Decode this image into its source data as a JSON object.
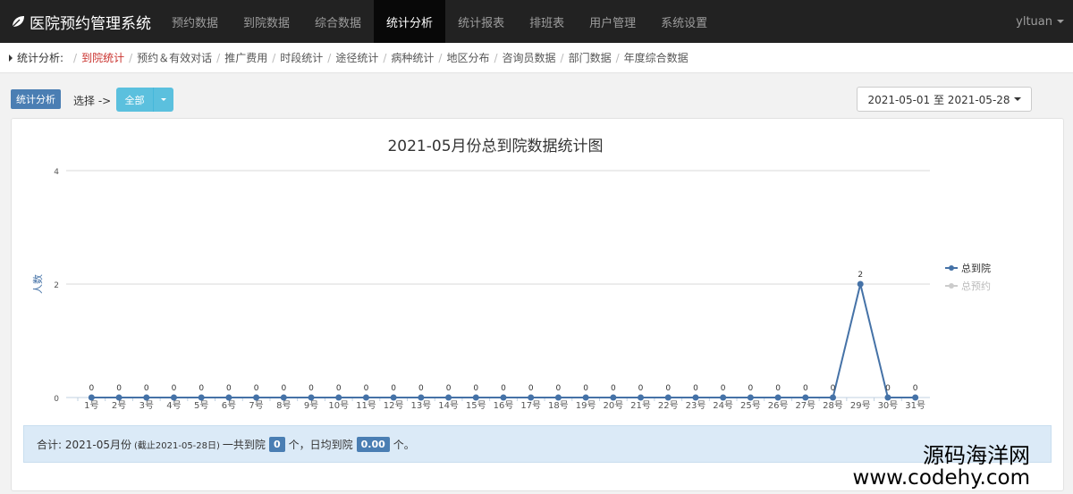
{
  "brand": {
    "title": "医院预约管理系统",
    "icon": "leaf-icon"
  },
  "nav": {
    "items": [
      "预约数据",
      "到院数据",
      "综合数据",
      "统计分析",
      "统计报表",
      "排班表",
      "用户管理",
      "系统设置"
    ],
    "active_index": 3,
    "user": "yltuan"
  },
  "breadcrumb": {
    "title": "统计分析:",
    "items": [
      "到院统计",
      "预约＆有效对话",
      "推广费用",
      "时段统计",
      "途径统计",
      "病种统计",
      "地区分布",
      "咨询员数据",
      "部门数据",
      "年度综合数据"
    ],
    "active_index": 0
  },
  "toolbar": {
    "badge": "统计分析",
    "select_label": "选择 ->",
    "select_value": "全部",
    "date_range": "2021-05-01 至 2021-05-28"
  },
  "chart_data": {
    "type": "line",
    "title": "2021-05月份总到院数据统计图",
    "ylabel": "人数",
    "ylim": [
      0,
      4
    ],
    "yticks": [
      0,
      2,
      4
    ],
    "categories": [
      "1号",
      "2号",
      "3号",
      "4号",
      "5号",
      "6号",
      "7号",
      "8号",
      "9号",
      "10号",
      "11号",
      "12号",
      "13号",
      "14号",
      "15号",
      "16号",
      "17号",
      "18号",
      "19号",
      "20号",
      "21号",
      "22号",
      "23号",
      "24号",
      "25号",
      "26号",
      "27号",
      "28号",
      "29号",
      "30号",
      "31号"
    ],
    "series": [
      {
        "name": "总到院",
        "color": "#4572a7",
        "values": [
          0,
          0,
          0,
          0,
          0,
          0,
          0,
          0,
          0,
          0,
          0,
          0,
          0,
          0,
          0,
          0,
          0,
          0,
          0,
          0,
          0,
          0,
          0,
          0,
          0,
          0,
          0,
          0,
          2,
          0,
          0
        ]
      },
      {
        "name": "总预约",
        "color": "#cccccc",
        "values": []
      }
    ],
    "legend": "right"
  },
  "summary": {
    "prefix": "合计: 2021-05月份",
    "note": "(截止2021-05-28日)",
    "text1": "一共到院",
    "total": "0",
    "text2": "个，日均到院",
    "avg": "0.00",
    "text3": "个。"
  },
  "watermark": {
    "line1": "源码海洋网",
    "line2": "www.codehy.com"
  }
}
